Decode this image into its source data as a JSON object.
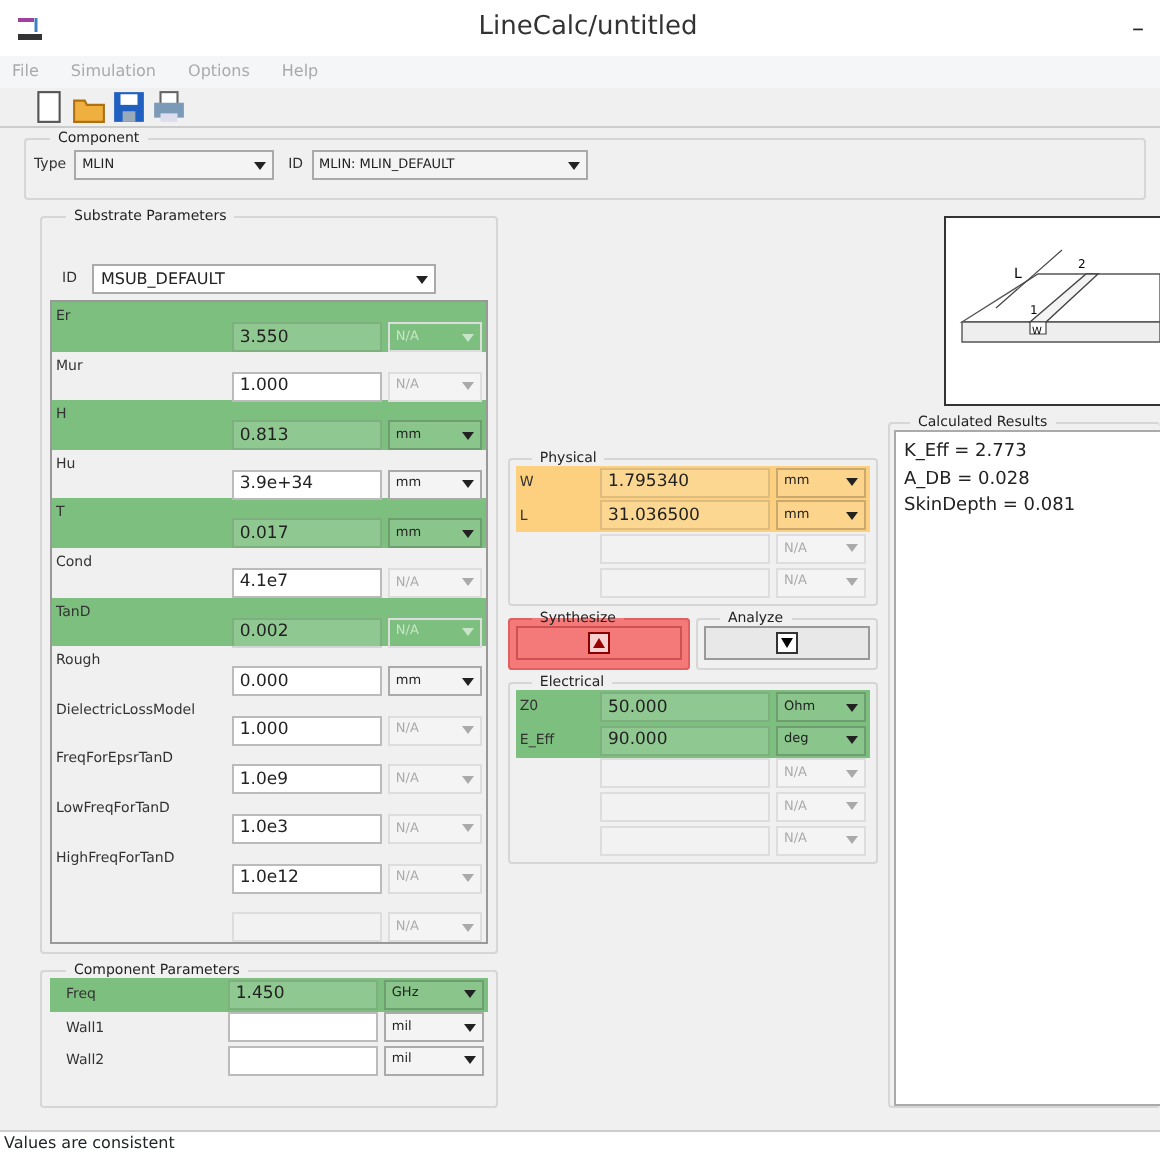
{
  "window": {
    "title": "LineCalc/untitled",
    "minimize": "–"
  },
  "menu": [
    {
      "label": "File"
    },
    {
      "label": "Simulation"
    },
    {
      "label": "Options"
    },
    {
      "label": "Help"
    }
  ],
  "toolbar": [
    {
      "kind": "new"
    },
    {
      "kind": "open"
    },
    {
      "kind": "save"
    },
    {
      "kind": "print"
    }
  ],
  "component": {
    "title": "Component",
    "type_label": "Type",
    "type_value": "MLIN",
    "id_label": "ID",
    "id_value": "MLIN: MLIN_DEFAULT"
  },
  "substrate": {
    "title": "Substrate Parameters",
    "id_label": "ID",
    "id_value": "MSUB_DEFAULT",
    "rows": [
      {
        "label": "Er",
        "value": "3.550",
        "unit": "N/A",
        "color": "#7dbf7e",
        "input_disabled": false,
        "unit_disabled": true
      },
      {
        "label": "Mur",
        "value": "1.000",
        "unit": "N/A",
        "input_disabled": false,
        "unit_disabled": true
      },
      {
        "label": "H",
        "value": "0.813",
        "unit": "mm",
        "color": "#7dbf7e",
        "input_disabled": false,
        "unit_disabled": false
      },
      {
        "label": "Hu",
        "value": "3.9e+34",
        "unit": "mm",
        "input_disabled": false,
        "unit_disabled": false
      },
      {
        "label": "T",
        "value": "0.017",
        "unit": "mm",
        "color": "#7dbf7e",
        "input_disabled": false,
        "unit_disabled": false
      },
      {
        "label": "Cond",
        "value": "4.1e7",
        "unit": "N/A",
        "input_disabled": false,
        "unit_disabled": true
      },
      {
        "label": "TanD",
        "value": "0.002",
        "unit": "N/A",
        "color": "#7dbf7e",
        "input_disabled": false,
        "unit_disabled": true
      },
      {
        "label": "Rough",
        "value": "0.000",
        "unit": "mm",
        "input_disabled": false,
        "unit_disabled": false
      },
      {
        "label": "DielectricLossModel",
        "value": "1.000",
        "unit": "N/A",
        "input_disabled": false,
        "unit_disabled": true
      },
      {
        "label": "FreqForEpsrTanD",
        "value": "1.0e9",
        "unit": "N/A",
        "input_disabled": false,
        "unit_disabled": true
      },
      {
        "label": "LowFreqForTanD",
        "value": "1.0e3",
        "unit": "N/A",
        "input_disabled": false,
        "unit_disabled": true
      },
      {
        "label": "HighFreqForTanD",
        "value": "1.0e12",
        "unit": "N/A",
        "input_disabled": false,
        "unit_disabled": true
      },
      {
        "unit": "N/A",
        "input_disabled": true,
        "unit_disabled": true
      }
    ]
  },
  "component_params": {
    "title": "Component Parameters",
    "rows": [
      {
        "label": "Freq",
        "value": "1.450",
        "unit": "GHz",
        "color": "#7dbf7e",
        "input_disabled": false,
        "unit_disabled": false
      },
      {
        "label": "Wall1",
        "unit": "mil",
        "input_disabled": false,
        "unit_disabled": false
      },
      {
        "label": "Wall2",
        "unit": "mil",
        "input_disabled": false,
        "unit_disabled": false
      }
    ]
  },
  "physical": {
    "title": "Physical",
    "rows": [
      {
        "label": "W",
        "value": "1.795340",
        "unit": "mm",
        "color": "#fcd07f",
        "input_disabled": false,
        "unit_disabled": false
      },
      {
        "label": "L",
        "value": "31.036500",
        "unit": "mm",
        "color": "#fcd07f",
        "input_disabled": false,
        "unit_disabled": false
      },
      {
        "unit": "N/A",
        "input_disabled": true,
        "unit_disabled": true
      },
      {
        "unit": "N/A",
        "input_disabled": true,
        "unit_disabled": true
      }
    ]
  },
  "synthesize": {
    "title": "Synthesize",
    "selected": true
  },
  "analyze": {
    "title": "Analyze",
    "selected": false
  },
  "electrical": {
    "title": "Electrical",
    "rows": [
      {
        "label": "Z0",
        "value": "50.000",
        "unit": "Ohm",
        "color": "#7dbf7e",
        "input_disabled": false,
        "unit_disabled": false
      },
      {
        "label": "E_Eff",
        "value": "90.000",
        "unit": "deg",
        "color": "#7dbf7e",
        "input_disabled": false,
        "unit_disabled": false
      },
      {
        "unit": "N/A",
        "input_disabled": true,
        "unit_disabled": true
      },
      {
        "unit": "N/A",
        "input_disabled": true,
        "unit_disabled": true
      },
      {
        "unit": "N/A",
        "input_disabled": true,
        "unit_disabled": true
      }
    ]
  },
  "diagram": {
    "labels": [
      "L",
      "W",
      "1",
      "2"
    ]
  },
  "results": {
    "title": "Calculated Results",
    "lines": [
      "K_Eff = 2.773",
      "A_DB = 0.028",
      "SkinDepth = 0.081"
    ]
  },
  "status_bar": "Values are consistent"
}
